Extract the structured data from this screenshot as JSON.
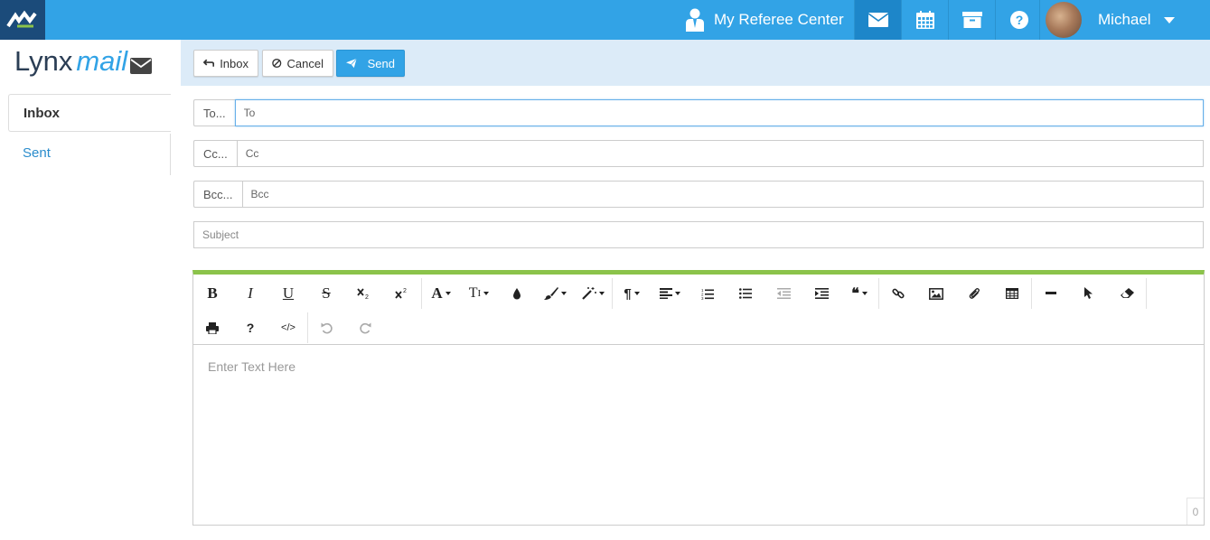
{
  "header": {
    "referee_center": "My Referee Center",
    "user_name": "Michael"
  },
  "brand": {
    "part1": "Lynx",
    "part2": "mail"
  },
  "sidebar": {
    "items": [
      {
        "label": "Inbox",
        "active": true
      },
      {
        "label": "Sent",
        "active": false
      }
    ]
  },
  "actions": {
    "inbox": "Inbox",
    "cancel": "Cancel",
    "send": "Send"
  },
  "fields": {
    "to_label": "To...",
    "to_placeholder": "To",
    "cc_label": "Cc...",
    "cc_placeholder": "Cc",
    "bcc_label": "Bcc...",
    "bcc_placeholder": "Bcc",
    "subject_placeholder": "Subject"
  },
  "editor": {
    "placeholder": "Enter Text Here",
    "char_count": "0",
    "toolbar_text": {
      "bold": "B",
      "italic": "I",
      "underline": "U",
      "strikethrough": "S",
      "font": "A",
      "font_size": "T",
      "paragraph": "¶",
      "quote": "❝",
      "help": "?",
      "code": "</>"
    }
  },
  "colors": {
    "topbar": "#32a3e6",
    "logo_bg": "#1b4b7a",
    "action_bar": "#dcebf8",
    "editor_accent": "#8bc34a",
    "primary_button": "#32a3e6"
  }
}
